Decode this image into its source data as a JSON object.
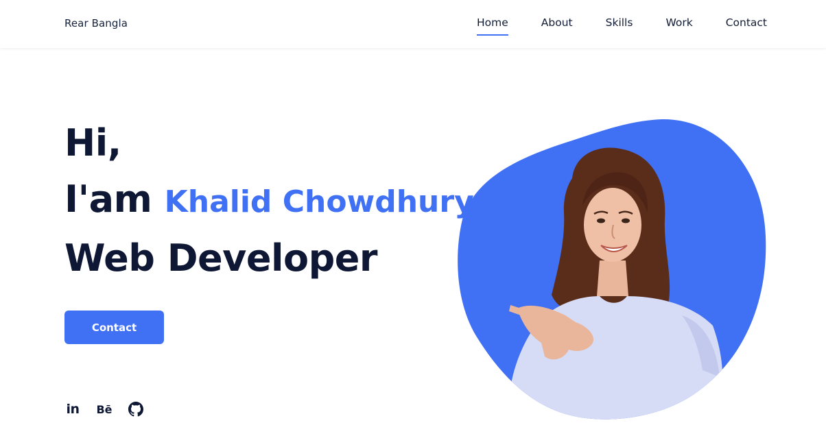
{
  "header": {
    "logo": "Rear Bangla",
    "nav": [
      {
        "label": "Home",
        "active": true
      },
      {
        "label": "About",
        "active": false
      },
      {
        "label": "Skills",
        "active": false
      },
      {
        "label": "Work",
        "active": false
      },
      {
        "label": "Contact",
        "active": false
      }
    ]
  },
  "hero": {
    "greeting": "Hi,",
    "intro": "I'am",
    "name": "Khalid Chowdhury",
    "role": "Web Developer",
    "cta_label": "Contact"
  },
  "socials": [
    {
      "icon": "linkedin-icon",
      "glyph": "in"
    },
    {
      "icon": "behance-icon",
      "glyph": "Bē"
    },
    {
      "icon": "github-icon"
    }
  ],
  "colors": {
    "accent": "#4070f4",
    "heading": "#0e1733",
    "background": "#ffffff"
  }
}
